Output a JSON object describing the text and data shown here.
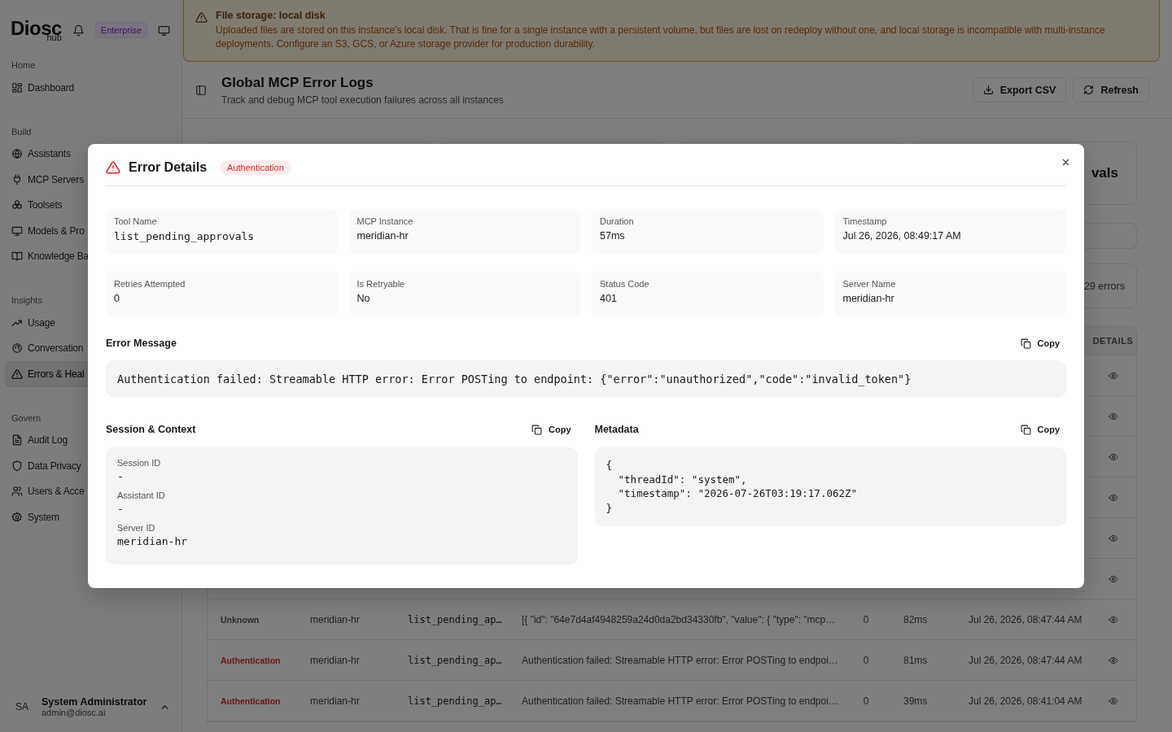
{
  "sidebar": {
    "logo": "Diosc",
    "logo_sub": "hub",
    "plan_badge": "Enterprise",
    "sections": [
      {
        "heading": "Home",
        "items": [
          {
            "label": "Dashboard",
            "selected": false
          }
        ]
      },
      {
        "heading": "Build",
        "items": [
          {
            "label": "Assistants",
            "selected": false
          },
          {
            "label": "MCP Servers",
            "selected": false
          },
          {
            "label": "Toolsets",
            "selected": false
          },
          {
            "label": "Models & Pro",
            "selected": false
          },
          {
            "label": "Knowledge Ba",
            "selected": false
          }
        ]
      },
      {
        "heading": "Insights",
        "items": [
          {
            "label": "Usage",
            "selected": false
          },
          {
            "label": "Conversation",
            "selected": false
          },
          {
            "label": "Errors & Heal",
            "selected": true
          }
        ]
      },
      {
        "heading": "Govern",
        "items": [
          {
            "label": "Audit Log",
            "selected": false
          },
          {
            "label": "Data Privacy",
            "selected": false
          },
          {
            "label": "Users & Acce",
            "selected": false
          },
          {
            "label": "System",
            "selected": false
          }
        ]
      }
    ],
    "user": {
      "initials": "SA",
      "name": "System Administrator",
      "email": "admin@diosc.ai"
    }
  },
  "alert": {
    "title": "File storage: local disk",
    "message": "Uploaded files are stored on this instance's local disk. That is fine for a single instance with a persistent volume, but files are lost on redeploy without one, and local storage is incompatible with multi-instance deployments. Configure an S3, GCS, or Azure storage provider for production durability."
  },
  "header": {
    "title": "Global MCP Error Logs",
    "subtitle": "Track and debug MCP tool execution failures across all instances",
    "buttons": [
      {
        "label": "Export CSV"
      },
      {
        "label": "Refresh"
      }
    ]
  },
  "summary_card": {
    "text": "vals"
  },
  "count_card": {
    "text": "29 errors"
  },
  "table": {
    "details_column": "DETAILS",
    "rows": [
      {
        "kind": "covered"
      },
      {
        "kind": "covered"
      },
      {
        "kind": "covered"
      },
      {
        "kind": "covered"
      },
      {
        "kind": "covered"
      },
      {
        "kind": "covered"
      },
      {
        "kind": "full",
        "color": "#29292e",
        "type": "Unknown",
        "instance": "meridian-hr",
        "tool": "list_pending_ap…",
        "message": "[{ \"id\": \"64e7d4af4948259a24d0da2bd34330fb\", \"value\": { \"type\": \"mcp…",
        "retries": "0",
        "duration": "82ms",
        "timestamp": "Jul 26, 2026, 08:47:44 AM"
      },
      {
        "kind": "full",
        "color": "#6e1313",
        "type": "Authentication",
        "instance": "meridian-hr",
        "tool": "list_pending_ap…",
        "message": "Authentication failed: Streamable HTTP error: Error POSTing to endpoi…",
        "retries": "0",
        "duration": "81ms",
        "timestamp": "Jul 26, 2026, 08:47:44 AM"
      },
      {
        "kind": "full",
        "color": "#6e1313",
        "type": "Authentication",
        "instance": "meridian-hr",
        "tool": "list_pending_ap…",
        "message": "Authentication failed: Streamable HTTP error: Error POSTing to endpoi…",
        "retries": "0",
        "duration": "39ms",
        "timestamp": "Jul 26, 2026, 08:41:04 AM"
      }
    ]
  },
  "modal": {
    "title": "Error Details",
    "badge": "Authentication",
    "fields": [
      {
        "label": "Tool Name",
        "value": "list_pending_approvals",
        "mono": true
      },
      {
        "label": "MCP Instance",
        "value": "meridian-hr",
        "mono": false
      },
      {
        "label": "Duration",
        "value": "57ms",
        "mono": false
      },
      {
        "label": "Timestamp",
        "value": "Jul 26, 2026, 08:49:17 AM",
        "mono": false
      },
      {
        "label": "Retries Attempted",
        "value": "0",
        "mono": false
      },
      {
        "label": "Is Retryable",
        "value": "No",
        "mono": false
      },
      {
        "label": "Status Code",
        "value": "401",
        "mono": false
      },
      {
        "label": "Server Name",
        "value": "meridian-hr",
        "mono": false
      }
    ],
    "error_message": {
      "heading": "Error Message",
      "copy": "Copy",
      "text": "Authentication failed: Streamable HTTP error: Error POSTing to endpoint: {\"error\":\"unauthorized\",\"code\":\"invalid_token\"}"
    },
    "session": {
      "heading": "Session & Context",
      "copy": "Copy",
      "items": [
        {
          "label": "Session ID",
          "value": "-"
        },
        {
          "label": "Assistant ID",
          "value": "-"
        },
        {
          "label": "Server ID",
          "value": "meridian-hr"
        }
      ]
    },
    "metadata": {
      "heading": "Metadata",
      "copy": "Copy",
      "text": "{\n  \"threadId\": \"system\",\n  \"timestamp\": \"2026-07-26T03:19:17.062Z\"\n}"
    }
  }
}
